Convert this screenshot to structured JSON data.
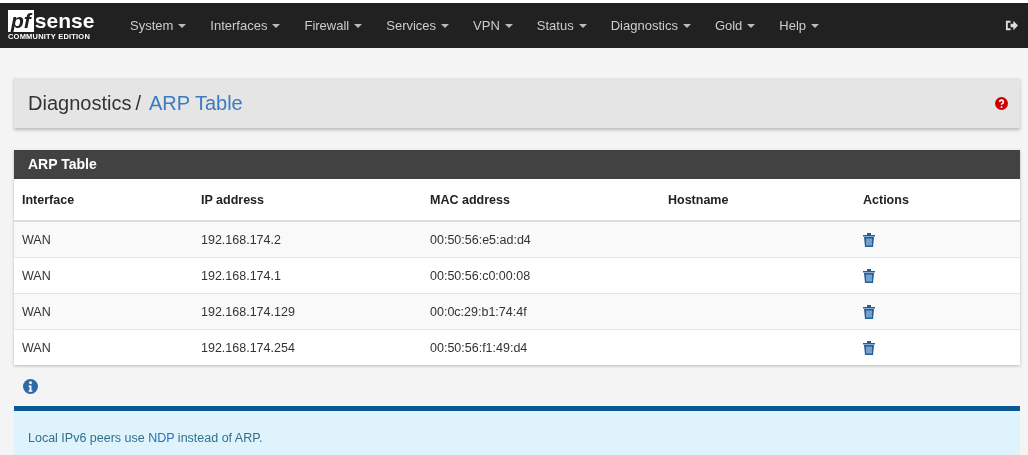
{
  "logo": {
    "mark": "pf",
    "name": "sense",
    "edition": "COMMUNITY EDITION"
  },
  "nav": [
    "System",
    "Interfaces",
    "Firewall",
    "Services",
    "VPN",
    "Status",
    "Diagnostics",
    "Gold",
    "Help"
  ],
  "breadcrumb": {
    "parent": "Diagnostics",
    "separator": "/",
    "current": "ARP Table"
  },
  "panel": {
    "title": "ARP Table",
    "columns": [
      "Interface",
      "IP address",
      "MAC address",
      "Hostname",
      "Actions"
    ],
    "rows": [
      {
        "interface": "WAN",
        "ip": "192.168.174.2",
        "mac": "00:50:56:e5:ad:d4"
      },
      {
        "interface": "WAN",
        "ip": "192.168.174.1",
        "mac": "00:50:56:c0:00:08"
      },
      {
        "interface": "WAN",
        "ip": "192.168.174.129",
        "mac": "00:0c:29:b1:74:4f"
      },
      {
        "interface": "WAN",
        "ip": "192.168.174.254",
        "mac": "00:50:56:f1:49:d4"
      }
    ]
  },
  "note": {
    "before": "Local IPv6 peers use",
    "link": "NDP",
    "after": "instead of ARP."
  }
}
